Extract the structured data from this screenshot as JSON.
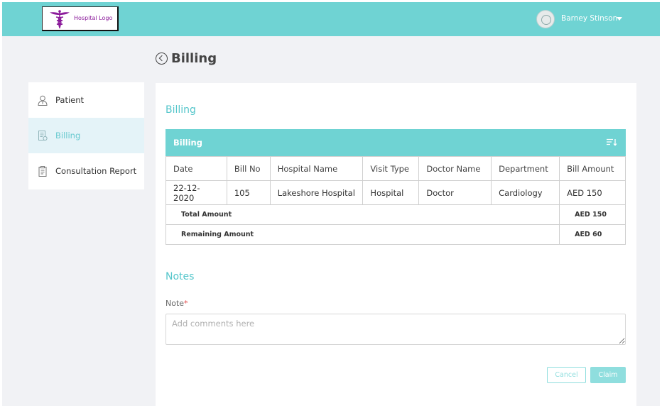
{
  "header": {
    "logo_text": "Hospital Logo",
    "user_name": "Barney Stinson",
    "accent_color": "#6fd3d3"
  },
  "page": {
    "title": "Billing"
  },
  "sidebar": {
    "items": [
      {
        "label": "Patient",
        "icon": "patient-icon",
        "active": false
      },
      {
        "label": "Billing",
        "icon": "billing-icon",
        "active": true
      },
      {
        "label": "Consultation Report",
        "icon": "report-icon",
        "active": false
      }
    ]
  },
  "billing": {
    "section_title": "Billing",
    "table_title": "Billing",
    "columns": [
      "Date",
      "Bill No",
      "Hospital Name",
      "Visit Type",
      "Doctor Name",
      "Department",
      "Bill Amount"
    ],
    "rows": [
      [
        "22-12-2020",
        "105",
        "Lakeshore Hospital",
        "Hospital",
        "Doctor",
        "Cardiology",
        "AED 150"
      ]
    ],
    "total_label": "Total Amount",
    "total_value": "AED 150",
    "remaining_label": "Remaining Amount",
    "remaining_value": "AED 60"
  },
  "notes": {
    "section_title": "Notes",
    "label": "Note",
    "required_mark": "*",
    "placeholder": "Add comments here",
    "value": ""
  },
  "actions": {
    "cancel_label": "Cancel",
    "claim_label": "Claim"
  }
}
